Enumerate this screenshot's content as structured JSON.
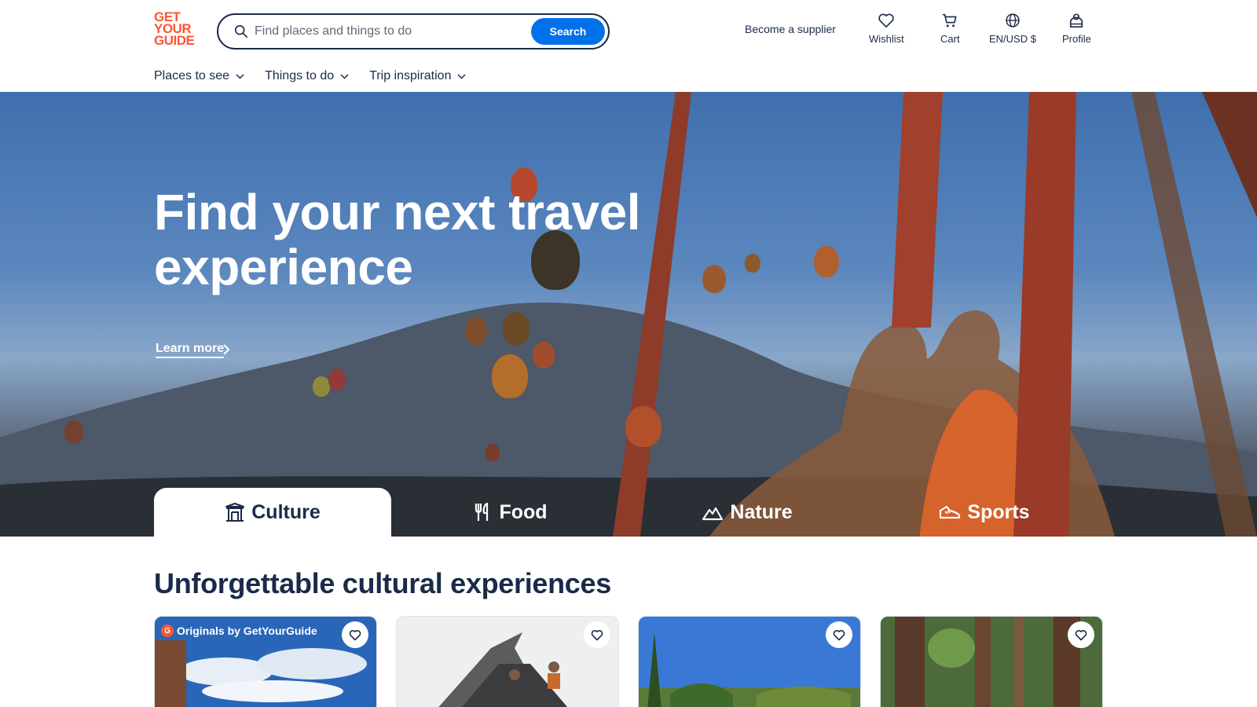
{
  "header": {
    "logo": [
      "GET",
      "YOUR",
      "GUIDE"
    ],
    "search_placeholder": "Find places and things to do",
    "search_button": "Search",
    "supplier_link": "Become a supplier",
    "actions": {
      "wishlist": "Wishlist",
      "cart": "Cart",
      "locale": "EN/USD $",
      "profile": "Profile"
    }
  },
  "subnav": [
    "Places to see",
    "Things to do",
    "Trip inspiration"
  ],
  "hero": {
    "title": "Find your next travel experience",
    "learn_more": "Learn more"
  },
  "tabs": [
    {
      "label": "Culture",
      "icon": "building-icon",
      "active": true
    },
    {
      "label": "Food",
      "icon": "fork-knife-icon",
      "active": false
    },
    {
      "label": "Nature",
      "icon": "mountain-icon",
      "active": false
    },
    {
      "label": "Sports",
      "icon": "sneaker-icon",
      "active": false
    }
  ],
  "section": {
    "title": "Unforgettable cultural experiences",
    "cards": [
      {
        "badge": "Originals by GetYourGuide",
        "image": "coastal-sky-photo"
      },
      {
        "badge": "",
        "image": "off-road-vehicle-photo"
      },
      {
        "badge": "",
        "image": "cypress-garden-photo"
      },
      {
        "badge": "",
        "image": "redwood-forest-photo"
      }
    ]
  },
  "colors": {
    "brand": "#ff5533",
    "primary": "#0071eb",
    "text": "#1a2b49"
  }
}
